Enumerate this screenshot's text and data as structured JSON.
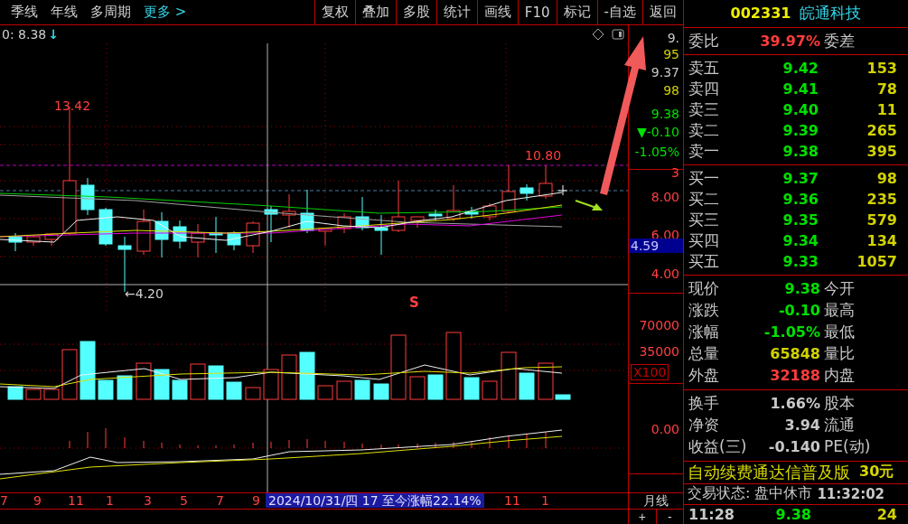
{
  "toolbar": {
    "left_items": [
      {
        "label": "季线",
        "kind": "period"
      },
      {
        "label": "年线",
        "kind": "period"
      },
      {
        "label": "多周期",
        "kind": "period"
      },
      {
        "label": "更多 >",
        "kind": "more"
      }
    ],
    "buttons": [
      "复权",
      "叠加",
      "多股",
      "统计",
      "画线",
      "F10",
      "标记",
      "-自选",
      "返回"
    ]
  },
  "info": {
    "text": "0: 8.38",
    "arrow": "↓"
  },
  "chart_labels": [
    {
      "kind": "high",
      "text": "13.42"
    },
    {
      "kind": "high",
      "text": "10.80"
    },
    {
      "kind": "low",
      "text": "←4.20"
    },
    {
      "kind": "signal",
      "text": "S"
    }
  ],
  "axis": {
    "quote_labels": [
      {
        "text": "9.",
        "kind": "plain"
      },
      {
        "text": "95",
        "kind": "volume"
      },
      {
        "text": "9.37",
        "kind": "plain"
      },
      {
        "text": "98",
        "kind": "volume"
      },
      {
        "text": "9.38",
        "kind": "down"
      },
      {
        "text": "▼-0.10",
        "kind": "down"
      },
      {
        "text": "-1.05%",
        "kind": "down"
      },
      {
        "text": "3",
        "kind": "up"
      }
    ],
    "price_ticks": [
      "8.00",
      "6.00",
      "4.00"
    ],
    "cursor_price": "4.59",
    "volume_ticks": [
      "70000",
      "35000"
    ],
    "volume_unit": "X100",
    "macd_ticks": [
      "0.00"
    ],
    "period": "月线",
    "zoom_buttons": [
      "+",
      "-"
    ]
  },
  "x_axis": {
    "labels": [
      "7",
      "9",
      "11",
      "1",
      "3",
      "5",
      "7",
      "9"
    ],
    "cursor_label": "2024/10/31/四 17 至今涨幅22.14%",
    "labels_after": [
      "11",
      "1"
    ]
  },
  "quote": {
    "code": "002331",
    "name": "皖通科技",
    "ratio": {
      "label": "委比",
      "value": "39.97%",
      "label2": "委差"
    },
    "sells": [
      {
        "label": "卖五",
        "price": "9.42",
        "volume": "153"
      },
      {
        "label": "卖四",
        "price": "9.41",
        "volume": "78"
      },
      {
        "label": "卖三",
        "price": "9.40",
        "volume": "11"
      },
      {
        "label": "卖二",
        "price": "9.39",
        "volume": "265"
      },
      {
        "label": "卖一",
        "price": "9.38",
        "volume": "395"
      }
    ],
    "buys": [
      {
        "label": "买一",
        "price": "9.37",
        "volume": "98"
      },
      {
        "label": "买二",
        "price": "9.36",
        "volume": "235"
      },
      {
        "label": "买三",
        "price": "9.35",
        "volume": "579"
      },
      {
        "label": "买四",
        "price": "9.34",
        "volume": "134"
      },
      {
        "label": "买五",
        "price": "9.33",
        "volume": "1057"
      }
    ],
    "stats": [
      {
        "label": "现价",
        "value": "9.38",
        "kind": "down",
        "label2": "今开"
      },
      {
        "label": "涨跌",
        "value": "-0.10",
        "kind": "down",
        "label2": "最高"
      },
      {
        "label": "涨幅",
        "value": "-1.05%",
        "kind": "down",
        "label2": "最低"
      },
      {
        "label": "总量",
        "value": "65848",
        "kind": "volume",
        "label2": "量比"
      },
      {
        "label": "外盘",
        "value": "32188",
        "kind": "up",
        "label2": "内盘"
      }
    ],
    "stats2": [
      {
        "label": "换手",
        "value": "1.66%",
        "label2": "股本"
      },
      {
        "label": "净资",
        "value": "3.94",
        "label2": "流通"
      },
      {
        "label": "收益(三)",
        "value": "-0.140",
        "label2": "PE(动)"
      }
    ],
    "banner": {
      "text": "自动续费通达信普及版",
      "price": "30元"
    },
    "status": {
      "label": "交易状态:",
      "value": "盘中休市",
      "time": "11:32:02"
    },
    "ticks": [
      {
        "time": "11:28",
        "price": "9.38",
        "volume": "24"
      }
    ]
  }
}
